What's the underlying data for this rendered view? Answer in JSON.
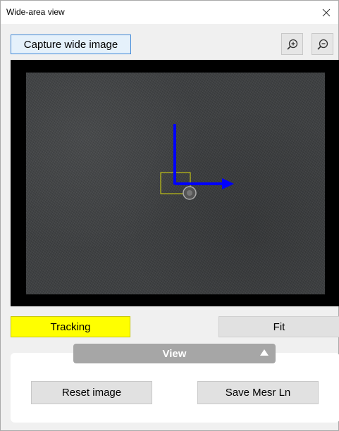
{
  "window": {
    "title": "Wide-area view",
    "close_icon": "close-icon"
  },
  "toolbar": {
    "capture_label": "Capture wide image",
    "zoom_in_icon": "zoom-in-icon",
    "zoom_out_icon": "zoom-out-icon"
  },
  "viewer": {
    "axis_color": "#0000ff",
    "roi_color": "#ffff00"
  },
  "controls": {
    "tracking_label": "Tracking",
    "tracking_color": "#ffff00",
    "fit_label": "Fit"
  },
  "view_panel": {
    "header_label": "View",
    "collapse_icon": "collapse-up-icon",
    "reset_label": "Reset image",
    "save_label": "Save Mesr Ln"
  }
}
